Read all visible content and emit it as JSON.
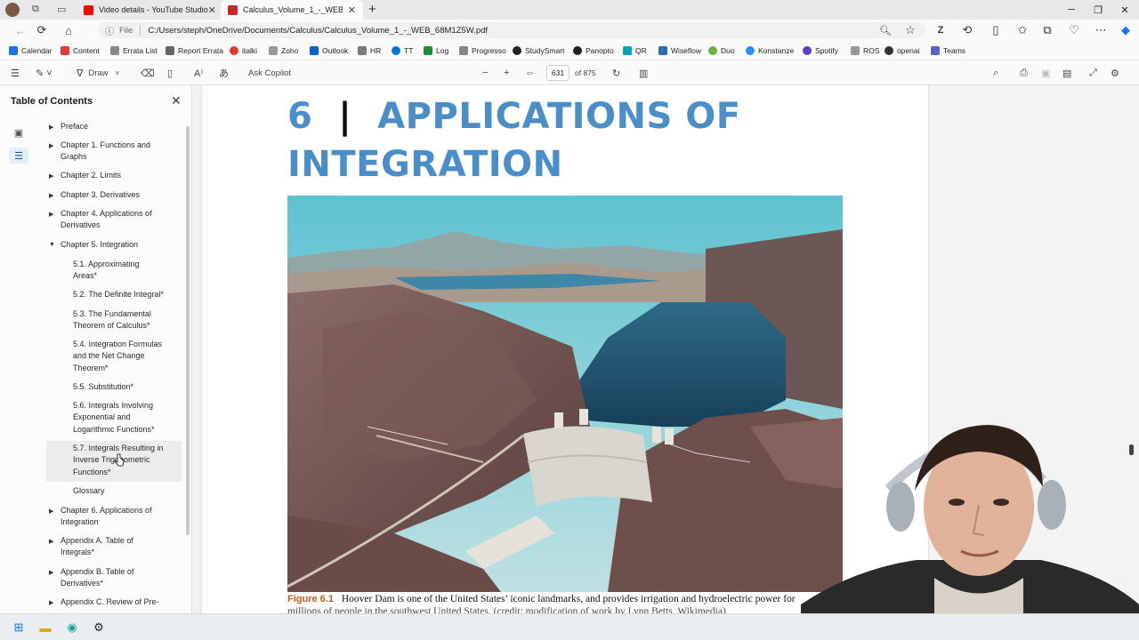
{
  "tabs": [
    {
      "label": "Video details - YouTube Studio",
      "icon": "youtube-icon",
      "active": false
    },
    {
      "label": "Calculus_Volume_1_-_WEB_68M",
      "icon": "pdf-icon",
      "active": true
    }
  ],
  "address": {
    "file_label": "File",
    "url": "C:/Users/steph/OneDrive/Documents/Calculus/Calculus_Volume_1_-_WEB_68M1Z5W.pdf"
  },
  "bookmarks": [
    {
      "label": "Calendar",
      "color": "#1a73e8"
    },
    {
      "label": "Content",
      "color": "#e53935"
    },
    {
      "label": "Errata List",
      "color": "#555555"
    },
    {
      "label": "Report Errata",
      "color": "#444444"
    },
    {
      "label": "italki",
      "color": "#e53935"
    },
    {
      "label": "Zoho",
      "color": "#555555"
    },
    {
      "label": "Outlook",
      "color": "#0a64c8"
    },
    {
      "label": "HR",
      "color": "#7a7a7a"
    },
    {
      "label": "TT",
      "color": "#0078d4"
    },
    {
      "label": "Log",
      "color": "#1d8f3a"
    },
    {
      "label": "Progresso",
      "color": "#555555"
    },
    {
      "label": "StudySmart",
      "color": "#222222"
    },
    {
      "label": "Panopto",
      "color": "#222222"
    },
    {
      "label": "QR",
      "color": "#00a6b4"
    },
    {
      "label": "Wiseflow",
      "color": "#2b6cb0"
    },
    {
      "label": "Duo",
      "color": "#6db33f"
    },
    {
      "label": "Konstanze",
      "color": "#2d8cff"
    },
    {
      "label": "Spotify",
      "color": "#5a3fc0"
    },
    {
      "label": "ROS",
      "color": "#7a7a7a"
    },
    {
      "label": "openai",
      "color": "#333333"
    },
    {
      "label": "Teams",
      "color": "#5b5fc7"
    }
  ],
  "pdf_toolbar": {
    "draw_label": "Draw",
    "copilot_label": "Ask Copilot",
    "page_number": "631",
    "page_count": "of 875"
  },
  "sidebar": {
    "title": "Table of Contents",
    "items": [
      {
        "label": "Preface",
        "level": 1,
        "caret": "closed"
      },
      {
        "label": "Chapter 1. Functions and Graphs",
        "level": 1,
        "caret": "closed"
      },
      {
        "label": "Chapter 2. Limits",
        "level": 1,
        "caret": "closed"
      },
      {
        "label": "Chapter 3. Derivatives",
        "level": 1,
        "caret": "closed"
      },
      {
        "label": "Chapter 4. Applications of Derivatives",
        "level": 1,
        "caret": "closed"
      },
      {
        "label": "Chapter 5. Integration",
        "level": 1,
        "caret": "open"
      },
      {
        "label": "5.1. Approximating Areas*",
        "level": 2
      },
      {
        "label": "5.2. The Definite Integral*",
        "level": 2
      },
      {
        "label": "5.3. The Fundamental Theorem of Calculus*",
        "level": 2
      },
      {
        "label": "5.4. Integration Formulas and the Net Change Theorem*",
        "level": 2
      },
      {
        "label": "5.5. Substitution*",
        "level": 2
      },
      {
        "label": "5.6. Integrals Involving Exponential and Logarithmic Functions*",
        "level": 2
      },
      {
        "label": "5.7. Integrals Resulting in Inverse Trigonometric Functions*",
        "level": 2
      },
      {
        "label": "Glossary",
        "level": 2
      },
      {
        "label": "Chapter 6. Applications of Integration",
        "level": 1,
        "caret": "closed"
      },
      {
        "label": "Appendix A. Table of Integrals*",
        "level": 1,
        "caret": "closed"
      },
      {
        "label": "Appendix B. Table of Derivatives*",
        "level": 1,
        "caret": "closed"
      },
      {
        "label": "Appendix C. Review of Pre-",
        "level": 1,
        "caret": "closed"
      }
    ]
  },
  "document": {
    "chapter_number": "6",
    "chapter_title_line1": "APPLICATIONS OF",
    "chapter_title_line2": "INTEGRATION",
    "figure_label": "Figure 6.1",
    "caption_line1": "Hoover Dam is one of the United States’ iconic landmarks, and provides irrigation and hydroelectric power for",
    "caption_line2": "millions of people in the southwest United States. (credit: modification of work by Lynn Betts, Wikimedia)"
  },
  "colors": {
    "chapter_title": "#4a8ec9",
    "figure_label": "#d05a1d",
    "accent": "#1a5fb4"
  }
}
